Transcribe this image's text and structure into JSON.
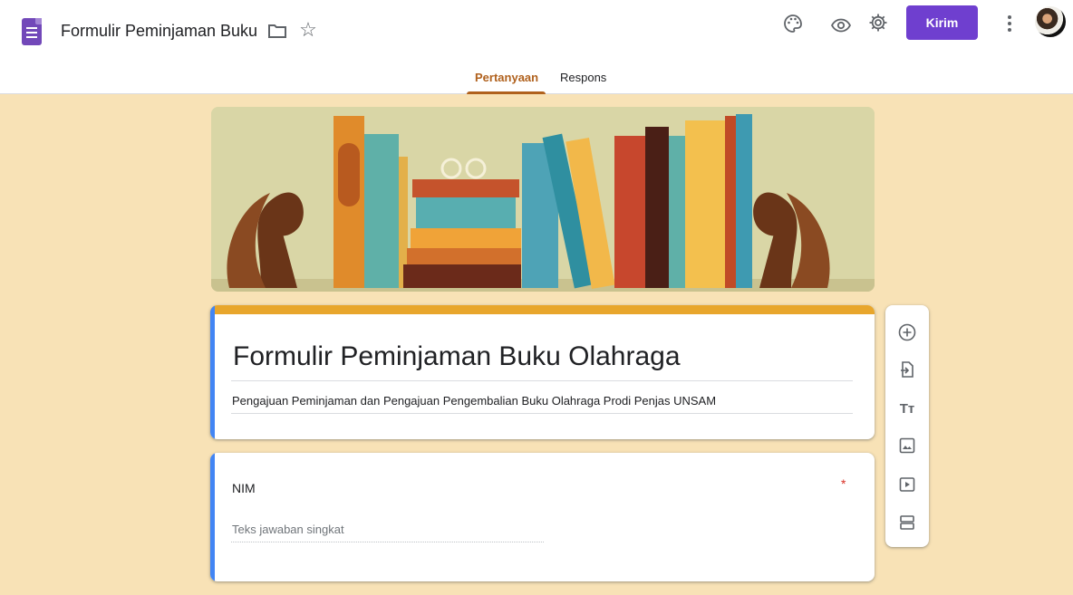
{
  "header": {
    "doc_title": "Formulir Peminjaman Buku",
    "send_label": "Kirim"
  },
  "tabs": [
    {
      "label": "Pertanyaan",
      "active": true
    },
    {
      "label": "Respons",
      "active": false
    }
  ],
  "form": {
    "title": "Formulir Peminjaman Buku Olahraga",
    "description": "Pengajuan Peminjaman dan Pengajuan Pengembalian Buku Olahraga Prodi Penjas UNSAM"
  },
  "question": {
    "label": "NIM",
    "required_marker": "*",
    "placeholder": "Teks jawaban singkat"
  },
  "toolbar": {
    "items": [
      "add-question-icon",
      "import-questions-icon",
      "add-title-icon",
      "add-image-icon",
      "add-video-icon",
      "add-section-icon"
    ],
    "title_glyph": "Tт"
  },
  "colors": {
    "accent": "#6f3fcf",
    "theme_background": "#f8e2b6",
    "title_stripe": "#e8a62c",
    "active_tab": "#b0611d",
    "focus_stripe": "#4285f4",
    "required": "#d93025"
  },
  "icons": {
    "app": "google-forms-icon",
    "folder": "folder-icon",
    "star": "star-icon",
    "palette": "palette-icon",
    "preview": "eye-icon",
    "settings": "gear-icon",
    "more": "more-vert-icon"
  }
}
